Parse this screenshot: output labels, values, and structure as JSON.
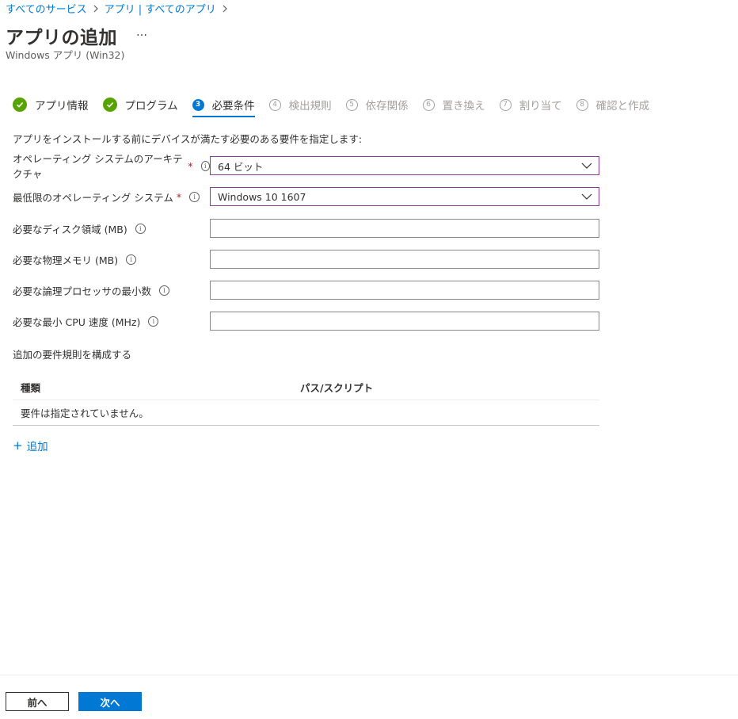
{
  "breadcrumb": [
    {
      "label": "すべてのサービス"
    },
    {
      "label": "アプリ | すべてのアプリ"
    }
  ],
  "header": {
    "title": "アプリの追加",
    "more": "…",
    "subtitle": "Windows アプリ (Win32)"
  },
  "wizard": {
    "steps": [
      {
        "number": "1",
        "label": "アプリ情報",
        "state": "done"
      },
      {
        "number": "2",
        "label": "プログラム",
        "state": "done"
      },
      {
        "number": "3",
        "label": "必要条件",
        "state": "active"
      },
      {
        "number": "4",
        "label": "検出規則",
        "state": "todo"
      },
      {
        "number": "5",
        "label": "依存関係",
        "state": "todo"
      },
      {
        "number": "6",
        "label": "置き換え",
        "state": "todo"
      },
      {
        "number": "7",
        "label": "割り当て",
        "state": "todo"
      },
      {
        "number": "8",
        "label": "確認と作成",
        "state": "todo"
      }
    ]
  },
  "description": "アプリをインストールする前にデバイスが満たす必要のある要件を指定します:",
  "form": {
    "os_arch": {
      "label": "オペレーティング システムのアーキテクチャ",
      "required": "*",
      "value": "64 ビット"
    },
    "min_os": {
      "label": "最低限のオペレーティング システム",
      "required": "*",
      "value": "Windows 10 1607"
    },
    "disk": {
      "label": "必要なディスク領域 (MB)",
      "value": ""
    },
    "memory": {
      "label": "必要な物理メモリ (MB)",
      "value": ""
    },
    "processors": {
      "label": "必要な論理プロセッサの最小数",
      "value": ""
    },
    "cpu_speed": {
      "label": "必要な最小 CPU 速度 (MHz)",
      "value": ""
    }
  },
  "rules": {
    "title": "追加の要件規則を構成する",
    "columns": [
      "種類",
      "パス/スクリプト"
    ],
    "empty_text": "要件は指定されていません。",
    "add_label": "追加",
    "add_symbol": "+"
  },
  "footer": {
    "prev_label": "前へ",
    "next_label": "次へ"
  },
  "colors": {
    "accent": "#0078d4",
    "success": "#57a300",
    "required": "#a4262c",
    "focus_border": "#8a3a9c"
  }
}
